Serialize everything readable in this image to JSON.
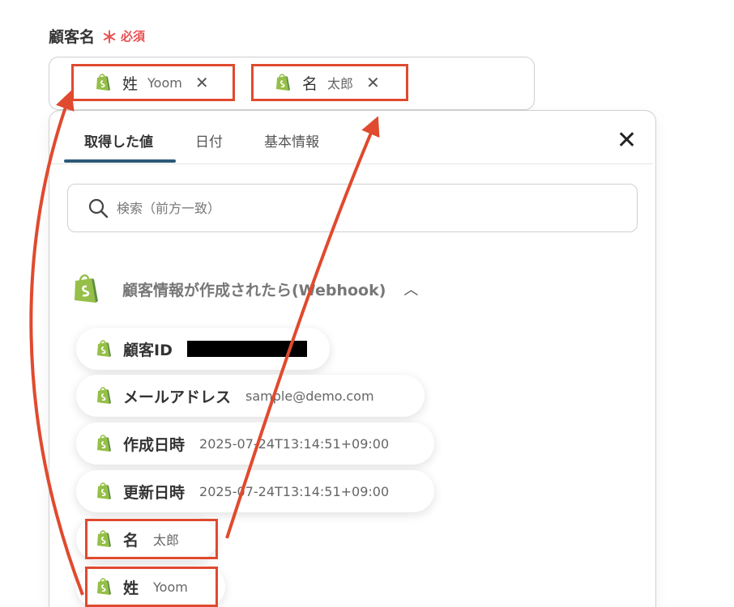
{
  "field": {
    "label": "顧客名",
    "required_star": "＊",
    "required_text": "必須"
  },
  "chips": [
    {
      "key": "姓",
      "value": "Yoom",
      "icon": "shopify-icon",
      "close_icon": "close-icon"
    },
    {
      "key": "名",
      "value": "太郎",
      "icon": "shopify-icon",
      "close_icon": "close-icon"
    }
  ],
  "tabs": [
    {
      "label": "取得した値",
      "active": true
    },
    {
      "label": "日付",
      "active": false
    },
    {
      "label": "基本情報",
      "active": false
    }
  ],
  "search": {
    "placeholder": "検索（前方一致）"
  },
  "section": {
    "title": "顧客情報が作成されたら(Webhook)",
    "icon": "shopify-icon",
    "chevron": "chevron-up-icon"
  },
  "items": [
    {
      "key": "顧客ID",
      "value": "",
      "redacted": true
    },
    {
      "key": "メールアドレス",
      "value": "sample@demo.com"
    },
    {
      "key": "作成日時",
      "value": "2025-07-24T13:14:51+09:00"
    },
    {
      "key": "更新日時",
      "value": "2025-07-24T13:14:51+09:00"
    },
    {
      "key": "名",
      "value": "太郎"
    },
    {
      "key": "姓",
      "value": "Yoom"
    }
  ],
  "colors": {
    "highlight": "#e04a2e",
    "required": "#e85050",
    "tab_indicator": "#2d5a77",
    "shopify_green": "#95bf47"
  }
}
